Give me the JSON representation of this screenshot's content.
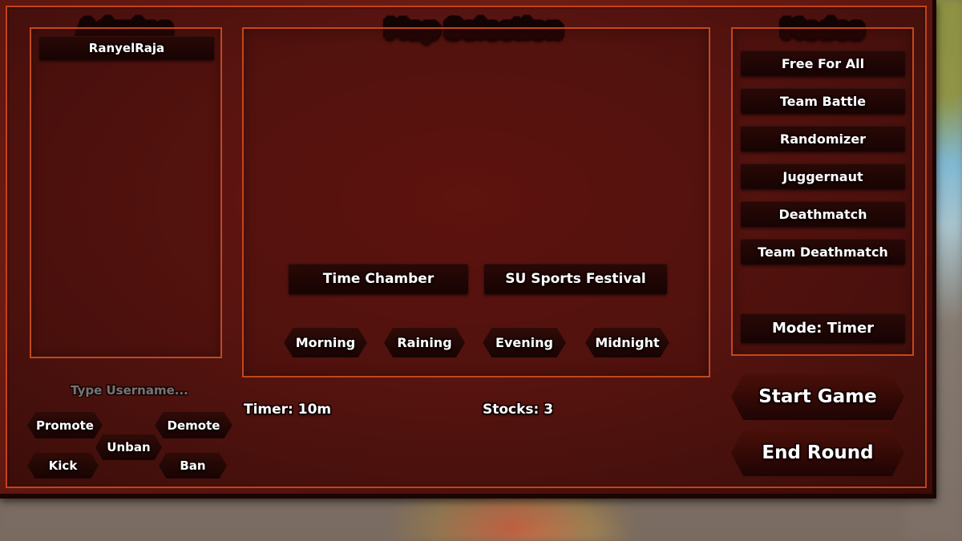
{
  "theme": {
    "panel_background": "#5a1410",
    "frame_border": "#c2481d",
    "button_fill": "#200604",
    "text_color": "#ffffff",
    "backdrop": "#7a6b61"
  },
  "admins": {
    "title": "Admins",
    "entries": [
      {
        "name": "RanyelRaja"
      }
    ],
    "username_field": {
      "placeholder": "Type Username...",
      "value": ""
    },
    "actions": [
      {
        "label": "Promote"
      },
      {
        "label": "Demote"
      },
      {
        "label": "Unban"
      },
      {
        "label": "Kick"
      },
      {
        "label": "Ban"
      }
    ]
  },
  "map_selection": {
    "title": "Map Selection",
    "maps": [
      {
        "label": "Time Chamber"
      },
      {
        "label": "SU Sports Festival"
      }
    ],
    "time_of_day": [
      {
        "label": "Morning"
      },
      {
        "label": "Raining"
      },
      {
        "label": "Evening"
      },
      {
        "label": "Midnight"
      }
    ]
  },
  "modes": {
    "title": "Modes",
    "items": [
      {
        "label": "Free For All"
      },
      {
        "label": "Team Battle"
      },
      {
        "label": "Randomizer"
      },
      {
        "label": "Juggernaut"
      },
      {
        "label": "Deathmatch"
      },
      {
        "label": "Team Deathmatch"
      }
    ],
    "mode_toggle": {
      "label": "Mode: Timer"
    }
  },
  "match_settings": {
    "timer": "Timer: 10m",
    "stocks": "Stocks: 3"
  },
  "round_controls": [
    {
      "label": "Start Game"
    },
    {
      "label": "End Round"
    }
  ]
}
